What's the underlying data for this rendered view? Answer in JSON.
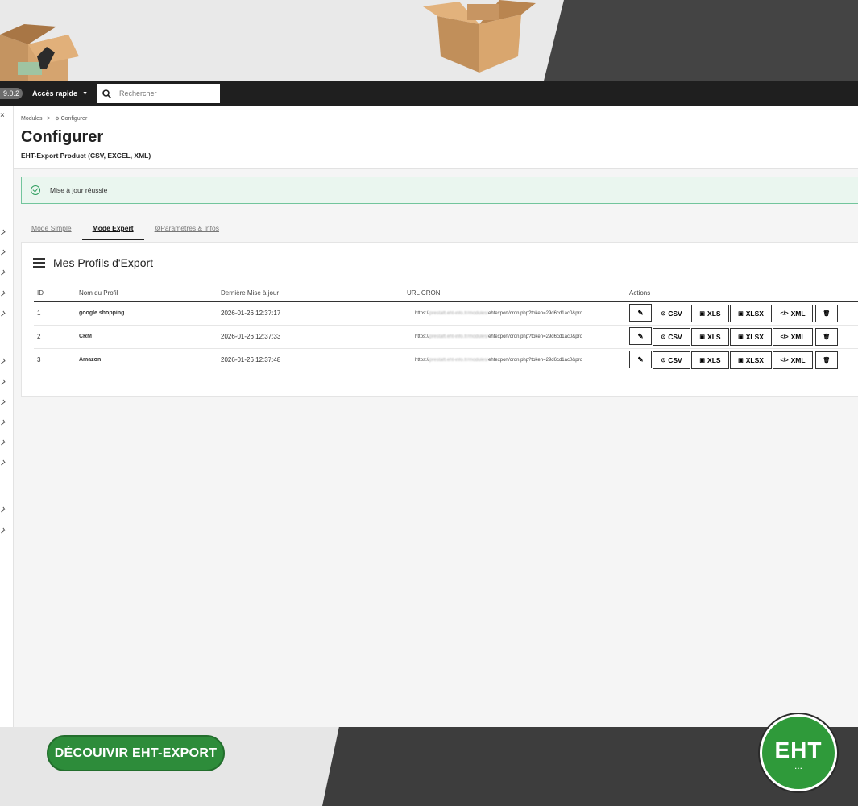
{
  "topbar": {
    "version": "9.0.2",
    "quick_access": "Accès rapide",
    "search_placeholder": "Rechercher"
  },
  "header": {
    "breadcrumb_parent": "Modules",
    "breadcrumb_sep": ">",
    "breadcrumb_current": "Configurer",
    "title": "Configurer",
    "subtitle": "EHT-Export Product (CSV, EXCEL, XML)"
  },
  "alert": {
    "message": "Mise à jour réussie"
  },
  "tabs": [
    {
      "label": "Mode Simple"
    },
    {
      "label": "Mode Expert"
    },
    {
      "label": "Paramètres & Infos"
    }
  ],
  "card": {
    "title": "Mes Profils d'Export",
    "columns": [
      "ID",
      "Nom du Profil",
      "Dernière Mise à jour",
      "URL CRON",
      "Actions"
    ],
    "rows": [
      {
        "id": "1",
        "name": "google shopping",
        "updated": "2026-01-26 12:37:17",
        "cron_prefix": "https://",
        "cron_hidden": "prestaft.eht-info.fr/modules/",
        "cron_suffix": "ehtexport/cron.php?token=29d6cd1ac0&pro"
      },
      {
        "id": "2",
        "name": "CRM",
        "updated": "2026-01-26 12:37:33",
        "cron_prefix": "https://",
        "cron_hidden": "prestaft.eht-info.fr/modules/",
        "cron_suffix": "ehtexport/cron.php?token=29d6cd1ac0&pro"
      },
      {
        "id": "3",
        "name": "Amazon",
        "updated": "2026-01-26 12:37:48",
        "cron_prefix": "https://",
        "cron_hidden": "prestaft.eht-info.fr/modules/",
        "cron_suffix": "ehtexport/cron.php?token=29d6cd1ac0&pro"
      }
    ],
    "actions": {
      "csv": "CSV",
      "xls": "XLS",
      "xlsx": "XLSX",
      "xml": "XML"
    }
  },
  "promo": {
    "cta": "DÉCOUIVIR EHT-EXPORT",
    "logo_text": "EHT",
    "logo_dots": "..."
  }
}
